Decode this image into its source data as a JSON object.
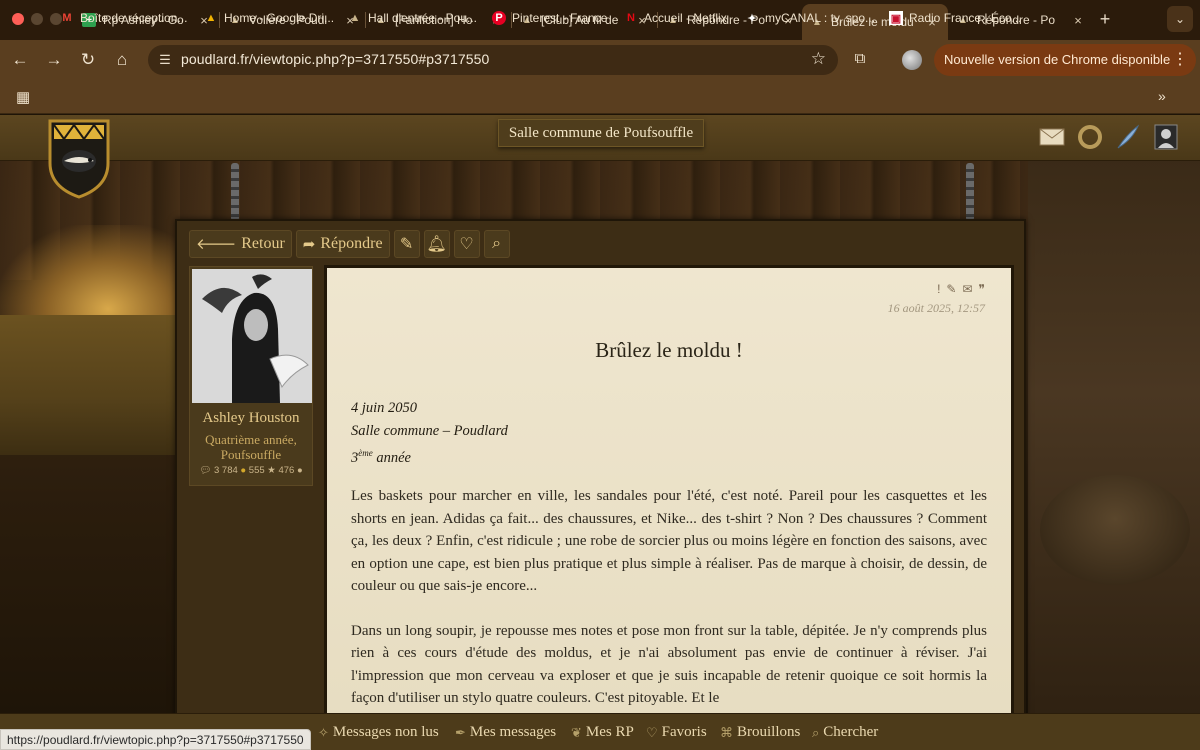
{
  "browser": {
    "tabs": [
      {
        "title": "Rp Ashley - Go",
        "icon": "sheets-icon"
      },
      {
        "title": "Volière - Poudl",
        "icon": "hat-icon"
      },
      {
        "title": "[Fanfiction] Ho",
        "icon": "hat-icon"
      },
      {
        "title": "[Club] Au fil de",
        "icon": "hat-icon"
      },
      {
        "title": "Répondre - Po",
        "icon": "hat-icon"
      },
      {
        "title": "Brûlez le moldu",
        "icon": "hat-icon",
        "active": true
      },
      {
        "title": "Répondre - Po",
        "icon": "hat-icon"
      }
    ],
    "close_glyph": "×",
    "new_tab_glyph": "+",
    "tab_menu_glyph": "⌄",
    "url": "poudlard.fr/viewtopic.php?p=3717550#p3717550",
    "update_label": "Nouvelle version de Chrome disponible",
    "bookmarks": [
      {
        "label": "Boîte de réception...",
        "icon": "gmail-icon"
      },
      {
        "label": "Home - Google Dri...",
        "icon": "drive-icon"
      },
      {
        "label": "Hall d'entrée - Pou...",
        "icon": "hat-icon"
      },
      {
        "label": "Pinterest - France",
        "icon": "pinterest-icon"
      },
      {
        "label": "Accueil - Netflix",
        "icon": "netflix-icon"
      },
      {
        "label": "myCANAL : tv, spo...",
        "icon": "canal-icon"
      },
      {
        "label": "Radio France | Éco...",
        "icon": "radiofrance-icon"
      }
    ],
    "status_url": "https://poudlard.fr/viewtopic.php?p=3717550#p3717550"
  },
  "site": {
    "room_title": "Salle commune de Poufsouffle",
    "actions": {
      "back": "Retour",
      "reply": "Répondre"
    },
    "author": {
      "name": "Ashley Houston",
      "rank": "Quatrième année, Poufsouffle",
      "stats": {
        "messages": "3 784",
        "coins": "555",
        "stars": "476"
      }
    },
    "post": {
      "date": "16 août 2025, 12:57",
      "title": "Brûlez le moldu !",
      "meta_date": "4 juin 2050",
      "meta_place": "Salle commune – Poudlard",
      "meta_year_num": "3",
      "meta_year_sup": "ème",
      "meta_year_word": " année",
      "paragraphs": [
        "Les baskets pour marcher en ville, les sandales pour l'été, c'est noté. Pareil pour les casquettes et les shorts en jean. Adidas ça fait... des chaussures, et Nike... des t-shirt ? Non ? Des chaussures ? Comment ça, les deux ? Enfin, c'est ridicule ; une robe de sorcier plus ou moins légère en fonction des saisons, avec en option une cape, est bien plus pratique et plus simple à réaliser. Pas de marque à choisir, de dessin, de couleur ou que sais-je encore...",
        "Dans un long soupir, je repousse mes notes et pose mon front sur la table, dépitée. Je n'y comprends plus rien à ces cours d'étude des moldus, et je n'ai absolument pas envie de continuer à réviser. J'ai l'impression que mon cerveau va exploser et que je suis incapable de retenir quoique ce soit hormis la façon d'utiliser un stylo quatre couleurs. C'est pitoyable. Et le"
      ]
    },
    "bottom_nav": [
      {
        "label": "Messages non lus",
        "icon": "sparkle-icon"
      },
      {
        "label": "Mes messages",
        "icon": "quill-icon"
      },
      {
        "label": "Mes RP",
        "icon": "leaf-icon"
      },
      {
        "label": "Favoris",
        "icon": "heart-icon"
      },
      {
        "label": "Brouillons",
        "icon": "scroll-icon"
      },
      {
        "label": "Chercher",
        "icon": "search-icon"
      }
    ]
  }
}
